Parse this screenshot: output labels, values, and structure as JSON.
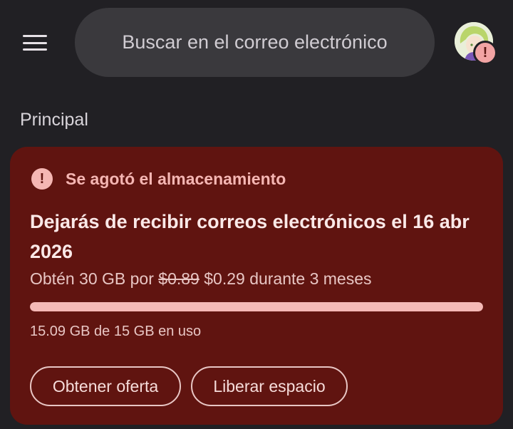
{
  "header": {
    "search_placeholder": "Buscar en el correo electrónico",
    "menu_icon": "hamburger-menu-icon",
    "avatar_badge": "!"
  },
  "section": {
    "label": "Principal"
  },
  "storage_card": {
    "warning_title": "Se agotó el almacenamiento",
    "warning_icon": "!",
    "headline": "Dejarás de recibir correos electrónicos el 16 abr 2026",
    "offer_prefix": "Obtén 30 GB por",
    "offer_old_price": "$0.89",
    "offer_new_price": "$0.29",
    "offer_suffix": "durante 3 meses",
    "usage_fraction": 1.0,
    "usage_text": "15.09 GB de 15 GB en uso",
    "buttons": {
      "get_offer": "Obtener oferta",
      "free_space": "Liberar espacio"
    }
  },
  "colors": {
    "background": "#212024",
    "card": "#601410",
    "accent": "#f5b6b3"
  }
}
